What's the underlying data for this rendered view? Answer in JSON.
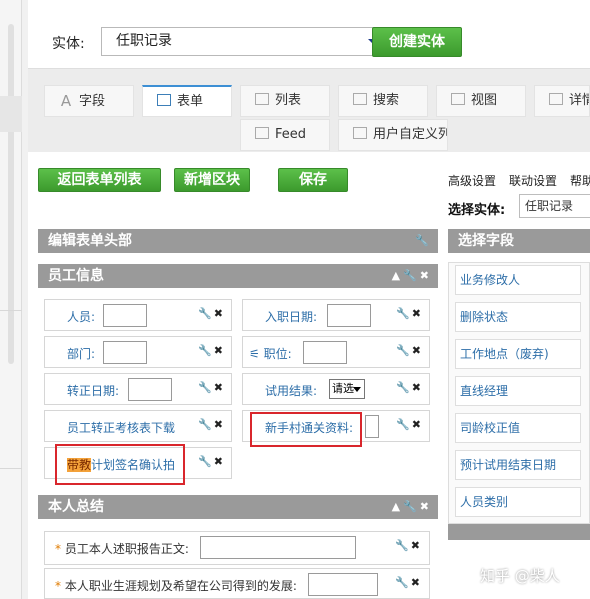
{
  "entity_bar": {
    "label": "实体:",
    "selected": "任职记录",
    "create_button": "创建实体"
  },
  "tabs": [
    {
      "label": "字段",
      "icon": "text-icon"
    },
    {
      "label": "表单",
      "icon": "form-icon"
    },
    {
      "label": "列表",
      "icon": "list-icon"
    },
    {
      "label": "搜索",
      "icon": "search-icon"
    },
    {
      "label": "视图",
      "icon": "view-icon"
    },
    {
      "label": "详情",
      "icon": "detail-icon"
    },
    {
      "label": "Feed",
      "icon": "feed-icon"
    },
    {
      "label": "用户自定义列",
      "icon": "custom-column-icon"
    }
  ],
  "actions": {
    "back": "返回表单列表",
    "add_block": "新增区块",
    "save": "保存"
  },
  "top_links": [
    "高级设置",
    "联动设置",
    "帮助"
  ],
  "choose_entity": {
    "label": "选择实体:",
    "value": "任职记录"
  },
  "sections": {
    "header": "编辑表单头部",
    "employee": "员工信息",
    "summary": "本人总结",
    "choose_fields": "选择字段"
  },
  "employee_fields": {
    "person": "人员:",
    "hire_date": "入职日期:",
    "department": "部门:",
    "position": "职位:",
    "regular_date": "转正日期:",
    "trial_result": "试用结果:",
    "trial_result_value": "请选",
    "download_link": "员工转正考核表下载",
    "newbie_material": "新手村通关资料:",
    "mentor_prefix": "带教",
    "mentor_rest": "计划签名确认拍"
  },
  "summary_fields": {
    "report": "员工本人述职报告正文:",
    "career_plan": "本人职业生涯规划及希望在公司得到的发展:"
  },
  "right_fields": [
    "业务修改人",
    "删除状态",
    "工作地点（废弃)",
    "直线经理",
    "司龄校正值",
    "预计试用结束日期",
    "人员类别"
  ],
  "watermark": "知乎 @柴人",
  "colors": {
    "green": "#3c9a2d",
    "section_gray": "#9a9a9a",
    "link_blue": "#2d6ea8",
    "highlight_red": "#d9262c"
  }
}
